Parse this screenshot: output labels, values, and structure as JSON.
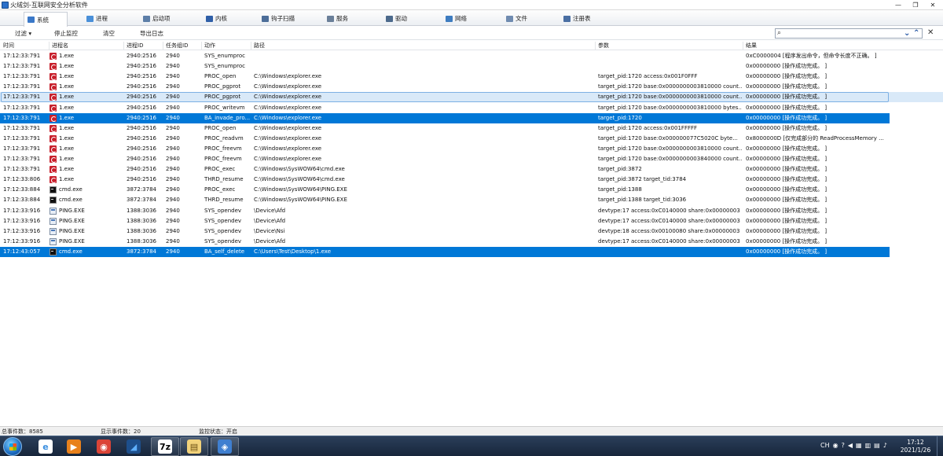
{
  "window": {
    "title": "火绒剑-互联网安全分析软件",
    "controls": [
      "—",
      "❐",
      "✕"
    ]
  },
  "tabs": [
    {
      "label": "系统",
      "icon": "system-icon",
      "color": "#3a78c8",
      "active": true
    },
    {
      "label": "进程",
      "icon": "process-icon",
      "color": "#4a90d9"
    },
    {
      "label": "启动项",
      "icon": "startup-icon",
      "color": "#5d7fa8"
    },
    {
      "label": "内核",
      "icon": "kernel-icon",
      "color": "#2f5fa8"
    },
    {
      "label": "钩子扫描",
      "icon": "hook-scan-icon",
      "color": "#4d6e99"
    },
    {
      "label": "服务",
      "icon": "service-icon",
      "color": "#6a7f99"
    },
    {
      "label": "驱动",
      "icon": "driver-icon",
      "color": "#4c6a8c"
    },
    {
      "label": "网络",
      "icon": "network-icon",
      "color": "#3e7cc0"
    },
    {
      "label": "文件",
      "icon": "file-icon",
      "color": "#6f8bb0"
    },
    {
      "label": "注册表",
      "icon": "registry-icon",
      "color": "#4a6fa3"
    }
  ],
  "toolbar": {
    "filter": "过滤 ▾",
    "stop": "停止监控",
    "clear": "清空",
    "export": "导出日志",
    "search_placeholder": ""
  },
  "columns": [
    "时间",
    "进程名",
    "进程ID",
    "任务组ID",
    "动作",
    "路径",
    "参数",
    "结果"
  ],
  "rows": [
    {
      "time": "17:12:33:791",
      "icon": "exe-icon",
      "proc": "1.exe",
      "pid": "2940:2516",
      "gid": "2940",
      "action": "SYS_enumproc",
      "path": "",
      "param": "",
      "result": "0xC0000004 [程序发出命令，但命令长度不正确。 ]"
    },
    {
      "time": "17:12:33:791",
      "icon": "exe-icon",
      "proc": "1.exe",
      "pid": "2940:2516",
      "gid": "2940",
      "action": "SYS_enumproc",
      "path": "",
      "param": "",
      "result": "0x00000000 [操作成功完成。 ]"
    },
    {
      "time": "17:12:33:791",
      "icon": "exe-icon",
      "proc": "1.exe",
      "pid": "2940:2516",
      "gid": "2940",
      "action": "PROC_open",
      "path": "C:\\Windows\\explorer.exe",
      "param": "target_pid:1720 access:0x001F0FFF",
      "result": "0x00000000 [操作成功完成。 ]"
    },
    {
      "time": "17:12:33:791",
      "icon": "exe-icon",
      "proc": "1.exe",
      "pid": "2940:2516",
      "gid": "2940",
      "action": "PROC_pgprot",
      "path": "C:\\Windows\\explorer.exe",
      "param": "target_pid:1720 base:0x0000000003810000 count...",
      "result": "0x00000000 [操作成功完成。 ]"
    },
    {
      "time": "17:12:33:791",
      "icon": "exe-icon",
      "proc": "1.exe",
      "pid": "2940:2516",
      "gid": "2940",
      "action": "PROC_pgprot",
      "path": "C:\\Windows\\explorer.exe",
      "param": "target_pid:1720 base:0x0000000003810000 count...",
      "result": "0x00000000 [操作成功完成。 ]",
      "state": "hover"
    },
    {
      "time": "17:12:33:791",
      "icon": "exe-icon",
      "proc": "1.exe",
      "pid": "2940:2516",
      "gid": "2940",
      "action": "PROC_writevm",
      "path": "C:\\Windows\\explorer.exe",
      "param": "target_pid:1720 base:0x0000000003810000 bytes...",
      "result": "0x00000000 [操作成功完成。 ]"
    },
    {
      "time": "17:12:33:791",
      "icon": "exe-icon",
      "proc": "1.exe",
      "pid": "2940:2516",
      "gid": "2940",
      "action": "BA_invade_pro...",
      "path": "C:\\Windows\\explorer.exe",
      "param": "target_pid:1720",
      "result": "0x00000000 [操作成功完成。 ]",
      "state": "selected"
    },
    {
      "time": "17:12:33:791",
      "icon": "exe-icon",
      "proc": "1.exe",
      "pid": "2940:2516",
      "gid": "2940",
      "action": "PROC_open",
      "path": "C:\\Windows\\explorer.exe",
      "param": "target_pid:1720 access:0x001FFFFF",
      "result": "0x00000000 [操作成功完成。 ]"
    },
    {
      "time": "17:12:33:791",
      "icon": "exe-icon",
      "proc": "1.exe",
      "pid": "2940:2516",
      "gid": "2940",
      "action": "PROC_readvm",
      "path": "C:\\Windows\\explorer.exe",
      "param": "target_pid:1720 base:0x000000077C5020C byte...",
      "result": "0x8000000D [仅完成部分的 ReadProcessMemory ..."
    },
    {
      "time": "17:12:33:791",
      "icon": "exe-icon",
      "proc": "1.exe",
      "pid": "2940:2516",
      "gid": "2940",
      "action": "PROC_freevm",
      "path": "C:\\Windows\\explorer.exe",
      "param": "target_pid:1720 base:0x0000000003810000 count...",
      "result": "0x00000000 [操作成功完成。 ]"
    },
    {
      "time": "17:12:33:791",
      "icon": "exe-icon",
      "proc": "1.exe",
      "pid": "2940:2516",
      "gid": "2940",
      "action": "PROC_freevm",
      "path": "C:\\Windows\\explorer.exe",
      "param": "target_pid:1720 base:0x0000000003840000 count...",
      "result": "0x00000000 [操作成功完成。 ]"
    },
    {
      "time": "17:12:33:791",
      "icon": "exe-icon",
      "proc": "1.exe",
      "pid": "2940:2516",
      "gid": "2940",
      "action": "PROC_exec",
      "path": "C:\\Windows\\SysWOW64\\cmd.exe",
      "param": "target_pid:3872",
      "result": "0x00000000 [操作成功完成。 ]"
    },
    {
      "time": "17:12:33:806",
      "icon": "exe-icon",
      "proc": "1.exe",
      "pid": "2940:2516",
      "gid": "2940",
      "action": "THRD_resume",
      "path": "C:\\Windows\\SysWOW64\\cmd.exe",
      "param": "target_pid:3872 target_tid:3784",
      "result": "0x00000000 [操作成功完成。 ]"
    },
    {
      "time": "17:12:33:884",
      "icon": "cmd-icon",
      "proc": "cmd.exe",
      "pid": "3872:3784",
      "gid": "2940",
      "action": "PROC_exec",
      "path": "C:\\Windows\\SysWOW64\\PING.EXE",
      "param": "target_pid:1388",
      "result": "0x00000000 [操作成功完成。 ]"
    },
    {
      "time": "17:12:33:884",
      "icon": "cmd-icon",
      "proc": "cmd.exe",
      "pid": "3872:3784",
      "gid": "2940",
      "action": "THRD_resume",
      "path": "C:\\Windows\\SysWOW64\\PING.EXE",
      "param": "target_pid:1388 target_tid:3036",
      "result": "0x00000000 [操作成功完成。 ]"
    },
    {
      "time": "17:12:33:916",
      "icon": "ping-icon",
      "proc": "PING.EXE",
      "pid": "1388:3036",
      "gid": "2940",
      "action": "SYS_opendev",
      "path": "\\Device\\Afd",
      "param": "devtype:17 access:0xC0140000 share:0x00000003",
      "result": "0x00000000 [操作成功完成。 ]"
    },
    {
      "time": "17:12:33:916",
      "icon": "ping-icon",
      "proc": "PING.EXE",
      "pid": "1388:3036",
      "gid": "2940",
      "action": "SYS_opendev",
      "path": "\\Device\\Afd",
      "param": "devtype:17 access:0xC0140000 share:0x00000003",
      "result": "0x00000000 [操作成功完成。 ]"
    },
    {
      "time": "17:12:33:916",
      "icon": "ping-icon",
      "proc": "PING.EXE",
      "pid": "1388:3036",
      "gid": "2940",
      "action": "SYS_opendev",
      "path": "\\Device\\Nsi",
      "param": "devtype:18 access:0x00100080 share:0x00000003",
      "result": "0x00000000 [操作成功完成。 ]"
    },
    {
      "time": "17:12:33:916",
      "icon": "ping-icon",
      "proc": "PING.EXE",
      "pid": "1388:3036",
      "gid": "2940",
      "action": "SYS_opendev",
      "path": "\\Device\\Afd",
      "param": "devtype:17 access:0xC0140000 share:0x00000003",
      "result": "0x00000000 [操作成功完成。 ]"
    },
    {
      "time": "17:12:43:057",
      "icon": "cmd-icon",
      "proc": "cmd.exe",
      "pid": "3872:3784",
      "gid": "2940",
      "action": "BA_self_delete",
      "path": "C:\\Users\\Test\\Desktop\\1.exe",
      "param": "",
      "result": "0x00000000 [操作成功完成。 ]",
      "state": "selected"
    }
  ],
  "status": {
    "total": "总事件数：8585",
    "shown": "显示事件数：20",
    "monitor": "监控状态：开启"
  },
  "taskbar": {
    "apps": [
      {
        "name": "ie-icon",
        "glyph": "e",
        "color": "#3b8fe0",
        "bg": "#ffffff"
      },
      {
        "name": "media-player-icon",
        "glyph": "▶",
        "color": "#ffffff",
        "bg": "#e8811c"
      },
      {
        "name": "chrome-icon",
        "glyph": "◉",
        "color": "#ffffff",
        "bg": "#db4437"
      },
      {
        "name": "app-icon",
        "glyph": "◢",
        "color": "#5fb0ff",
        "bg": "#1d4f8c"
      },
      {
        "name": "7zip-icon",
        "glyph": "7z",
        "color": "#000000",
        "bg": "#ffffff"
      },
      {
        "name": "explorer-icon",
        "glyph": "▤",
        "color": "#6b4e12",
        "bg": "#f2d27a"
      },
      {
        "name": "huorong-icon",
        "glyph": "◈",
        "color": "#ffffff",
        "bg": "#3f7fd0"
      }
    ],
    "tray": [
      "CH",
      "◉",
      "?",
      "◀",
      "▦",
      "▥",
      "▤",
      "♪"
    ],
    "time": "17:12",
    "date": "2021/1/26"
  }
}
